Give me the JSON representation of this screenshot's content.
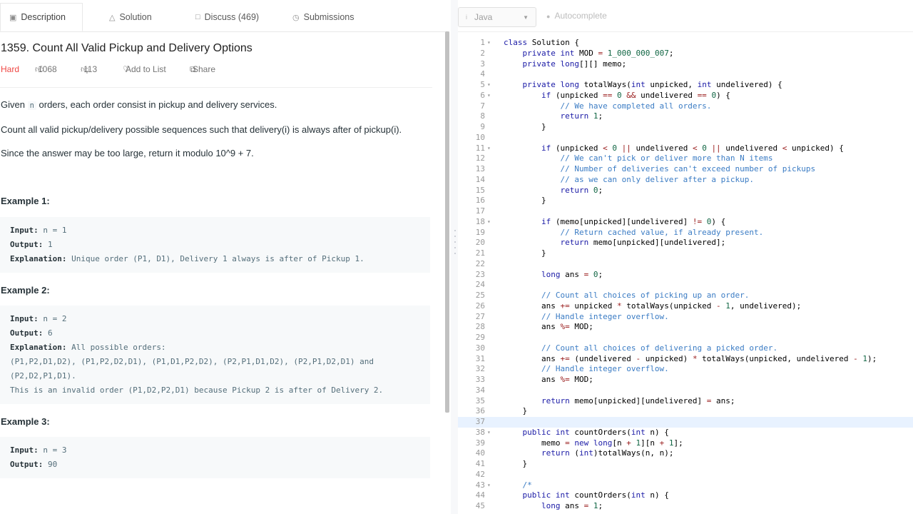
{
  "tabs": [
    {
      "label": "Description",
      "icon": "document-icon"
    },
    {
      "label": "Solution",
      "icon": "flask-icon"
    },
    {
      "label": "Discuss (469)",
      "icon": "chat-icon"
    },
    {
      "label": "Submissions",
      "icon": "history-icon"
    }
  ],
  "problem": {
    "title": "1359. Count All Valid Pickup and Delivery Options",
    "difficulty": "Hard",
    "likes": "1068",
    "dislikes": "113",
    "add_to_list": "Add to List",
    "share": "Share",
    "desc_1_pre": "Given ",
    "desc_1_code": "n",
    "desc_1_post": " orders, each order consist in pickup and delivery services.",
    "desc_2": "Count all valid pickup/delivery possible sequences such that delivery(i) is always after of pickup(i).",
    "desc_3": "Since the answer may be too large, return it modulo 10^9 + 7."
  },
  "examples": [
    {
      "title": "Example 1:",
      "lines": [
        {
          "label": "Input:",
          "text": " n = 1"
        },
        {
          "label": "Output:",
          "text": " 1"
        },
        {
          "label": "Explanation:",
          "text": " Unique order (P1, D1), Delivery 1 always is after of Pickup 1."
        }
      ]
    },
    {
      "title": "Example 2:",
      "lines": [
        {
          "label": "Input:",
          "text": " n = 2"
        },
        {
          "label": "Output:",
          "text": " 6"
        },
        {
          "label": "Explanation:",
          "text": " All possible orders: "
        },
        {
          "label": "",
          "text": "(P1,P2,D1,D2), (P1,P2,D2,D1), (P1,D1,P2,D2), (P2,P1,D1,D2), (P2,P1,D2,D1) and"
        },
        {
          "label": "",
          "text": "(P2,D2,P1,D1)."
        },
        {
          "label": "",
          "text": "This is an invalid order (P1,D2,P2,D1) because Pickup 2 is after of Delivery 2."
        }
      ]
    },
    {
      "title": "Example 3:",
      "lines": [
        {
          "label": "Input:",
          "text": " n = 3"
        },
        {
          "label": "Output:",
          "text": " 90"
        }
      ]
    }
  ],
  "editor": {
    "language": "Java",
    "autocomplete": "Autocomplete",
    "active_line": 37,
    "code": [
      {
        "n": "1",
        "fold": true,
        "t": "class Solution {"
      },
      {
        "n": "2",
        "fold": false,
        "t": "    private int MOD = 1_000_000_007;"
      },
      {
        "n": "3",
        "fold": false,
        "t": "    private long[][] memo;"
      },
      {
        "n": "4",
        "fold": false,
        "t": ""
      },
      {
        "n": "5",
        "fold": true,
        "t": "    private long totalWays(int unpicked, int undelivered) {"
      },
      {
        "n": "6",
        "fold": true,
        "t": "        if (unpicked == 0 && undelivered == 0) {"
      },
      {
        "n": "7",
        "fold": false,
        "t": "            // We have completed all orders."
      },
      {
        "n": "8",
        "fold": false,
        "t": "            return 1;"
      },
      {
        "n": "9",
        "fold": false,
        "t": "        }"
      },
      {
        "n": "10",
        "fold": false,
        "t": ""
      },
      {
        "n": "11",
        "fold": true,
        "t": "        if (unpicked < 0 || undelivered < 0 || undelivered < unpicked) {"
      },
      {
        "n": "12",
        "fold": false,
        "t": "            // We can't pick or deliver more than N items"
      },
      {
        "n": "13",
        "fold": false,
        "t": "            // Number of deliveries can't exceed number of pickups"
      },
      {
        "n": "14",
        "fold": false,
        "t": "            // as we can only deliver after a pickup."
      },
      {
        "n": "15",
        "fold": false,
        "t": "            return 0;"
      },
      {
        "n": "16",
        "fold": false,
        "t": "        }"
      },
      {
        "n": "17",
        "fold": false,
        "t": ""
      },
      {
        "n": "18",
        "fold": true,
        "t": "        if (memo[unpicked][undelivered] != 0) {"
      },
      {
        "n": "19",
        "fold": false,
        "t": "            // Return cached value, if already present."
      },
      {
        "n": "20",
        "fold": false,
        "t": "            return memo[unpicked][undelivered];"
      },
      {
        "n": "21",
        "fold": false,
        "t": "        }"
      },
      {
        "n": "22",
        "fold": false,
        "t": ""
      },
      {
        "n": "23",
        "fold": false,
        "t": "        long ans = 0;"
      },
      {
        "n": "24",
        "fold": false,
        "t": ""
      },
      {
        "n": "25",
        "fold": false,
        "t": "        // Count all choices of picking up an order."
      },
      {
        "n": "26",
        "fold": false,
        "t": "        ans += unpicked * totalWays(unpicked - 1, undelivered);"
      },
      {
        "n": "27",
        "fold": false,
        "t": "        // Handle integer overflow."
      },
      {
        "n": "28",
        "fold": false,
        "t": "        ans %= MOD;"
      },
      {
        "n": "29",
        "fold": false,
        "t": ""
      },
      {
        "n": "30",
        "fold": false,
        "t": "        // Count all choices of delivering a picked order."
      },
      {
        "n": "31",
        "fold": false,
        "t": "        ans += (undelivered - unpicked) * totalWays(unpicked, undelivered - 1);"
      },
      {
        "n": "32",
        "fold": false,
        "t": "        // Handle integer overflow."
      },
      {
        "n": "33",
        "fold": false,
        "t": "        ans %= MOD;"
      },
      {
        "n": "34",
        "fold": false,
        "t": ""
      },
      {
        "n": "35",
        "fold": false,
        "t": "        return memo[unpicked][undelivered] = ans;"
      },
      {
        "n": "36",
        "fold": false,
        "t": "    }"
      },
      {
        "n": "37",
        "fold": false,
        "t": ""
      },
      {
        "n": "38",
        "fold": true,
        "t": "    public int countOrders(int n) {"
      },
      {
        "n": "39",
        "fold": false,
        "t": "        memo = new long[n + 1][n + 1];"
      },
      {
        "n": "40",
        "fold": false,
        "t": "        return (int)totalWays(n, n);"
      },
      {
        "n": "41",
        "fold": false,
        "t": "    }"
      },
      {
        "n": "42",
        "fold": false,
        "t": ""
      },
      {
        "n": "43",
        "fold": true,
        "t": "    /*"
      },
      {
        "n": "44",
        "fold": false,
        "t": "    public int countOrders(int n) {"
      },
      {
        "n": "45",
        "fold": false,
        "t": "        long ans = 1;"
      }
    ]
  },
  "colors": {
    "hard": "#ef4743",
    "keyword": "#1a1aa6",
    "number": "#116644",
    "comment": "#3b7cc4",
    "active_line": "#e8f2ff"
  }
}
